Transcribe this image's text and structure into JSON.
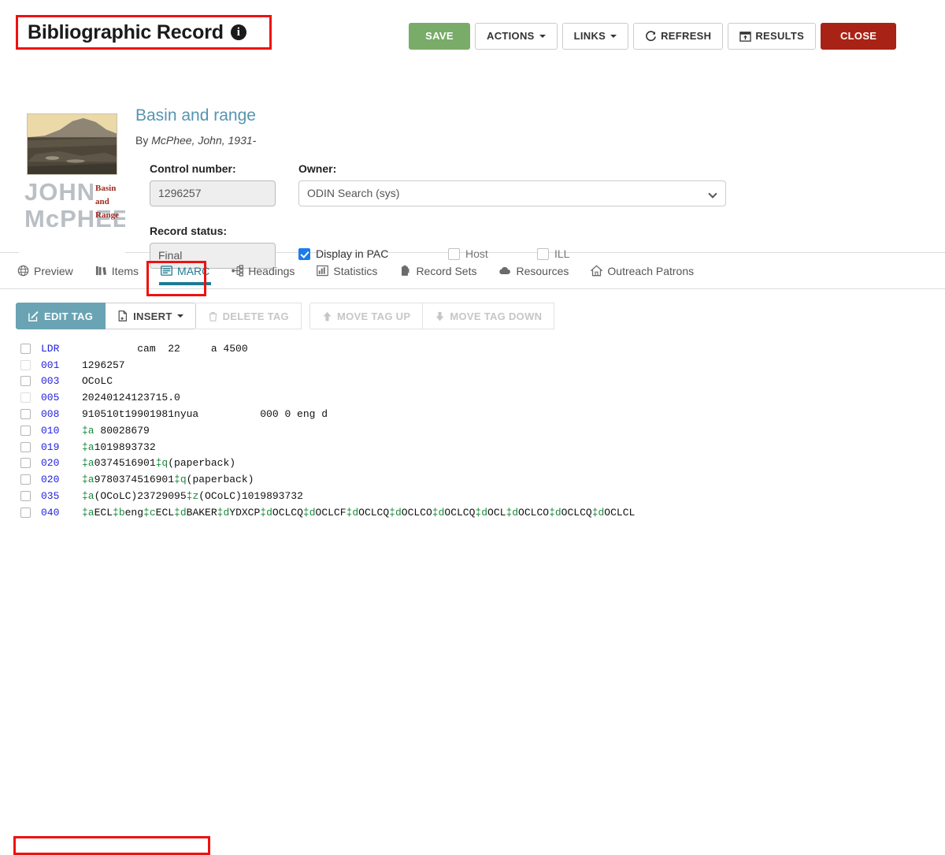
{
  "header": {
    "title": "Bibliographic Record",
    "info_icon": "info-circle-icon"
  },
  "toolbar": {
    "save": "SAVE",
    "actions": "ACTIONS",
    "links": "LINKS",
    "refresh": "REFRESH",
    "results": "RESULTS",
    "close": "CLOSE",
    "save_color": "#79ab69",
    "close_color": "#a82315"
  },
  "record": {
    "title": "Basin and range",
    "by_prefix": "By ",
    "author": "McPhee, John, 1931-",
    "cover": {
      "author_line1": "JOHN",
      "author_line2": "McPHEE",
      "title_line1": "Basin",
      "title_line2": "and",
      "title_line3": "Range"
    }
  },
  "form": {
    "control_number_label": "Control number:",
    "control_number_value": "1296257",
    "owner_label": "Owner:",
    "owner_value": "ODIN Search (sys)",
    "record_status_label": "Record status:",
    "record_status_value": "Final",
    "display_in_pac": "Display in PAC",
    "host": "Host",
    "ill": "ILL"
  },
  "tabs": [
    {
      "label": "Preview",
      "icon": "globe-icon",
      "active": false
    },
    {
      "label": "Items",
      "icon": "books-icon",
      "active": false
    },
    {
      "label": "MARC",
      "icon": "list-panel-icon",
      "active": true
    },
    {
      "label": "Headings",
      "icon": "sitemap-icon",
      "active": false
    },
    {
      "label": "Statistics",
      "icon": "bar-chart-icon",
      "active": false
    },
    {
      "label": "Record Sets",
      "icon": "clipboard-icon",
      "active": false
    },
    {
      "label": "Resources",
      "icon": "cloud-icon",
      "active": false
    },
    {
      "label": "Outreach Patrons",
      "icon": "home-icon",
      "active": false
    }
  ],
  "marc_toolbar": {
    "edit_tag": "EDIT TAG",
    "insert": "INSERT",
    "delete_tag": "DELETE TAG",
    "move_tag_up": "MOVE TAG UP",
    "move_tag_down": "MOVE TAG DOWN",
    "edit_tag_color": "#6aa3b3"
  },
  "marc_rows": [
    {
      "tag": "LDR",
      "checkbox_faint": false,
      "parts": [
        {
          "t": "         cam  22     a 4500",
          "sf": false
        }
      ]
    },
    {
      "tag": "001",
      "checkbox_faint": true,
      "parts": [
        {
          "t": "1296257",
          "sf": false
        }
      ]
    },
    {
      "tag": "003",
      "checkbox_faint": false,
      "parts": [
        {
          "t": "OCoLC",
          "sf": false
        }
      ]
    },
    {
      "tag": "005",
      "checkbox_faint": true,
      "parts": [
        {
          "t": "20240124123715.0",
          "sf": false
        }
      ]
    },
    {
      "tag": "008",
      "checkbox_faint": false,
      "parts": [
        {
          "t": "910510t19901981nyua          000 0 eng d",
          "sf": false
        }
      ]
    },
    {
      "tag": "010",
      "checkbox_faint": false,
      "parts": [
        {
          "t": "‡a",
          "sf": true
        },
        {
          "t": " 80028679",
          "sf": false
        }
      ]
    },
    {
      "tag": "019",
      "checkbox_faint": false,
      "parts": [
        {
          "t": "‡a",
          "sf": true
        },
        {
          "t": "1019893732",
          "sf": false
        }
      ]
    },
    {
      "tag": "020",
      "checkbox_faint": false,
      "parts": [
        {
          "t": "‡a",
          "sf": true
        },
        {
          "t": "0374516901",
          "sf": false
        },
        {
          "t": "‡q",
          "sf": true
        },
        {
          "t": "(paperback)",
          "sf": false
        }
      ]
    },
    {
      "tag": "020",
      "checkbox_faint": false,
      "parts": [
        {
          "t": "‡a",
          "sf": true
        },
        {
          "t": "9780374516901",
          "sf": false
        },
        {
          "t": "‡q",
          "sf": true
        },
        {
          "t": "(paperback)",
          "sf": false
        }
      ]
    },
    {
      "tag": "035",
      "checkbox_faint": false,
      "parts": [
        {
          "t": "‡a",
          "sf": true
        },
        {
          "t": "(OCoLC)23729095",
          "sf": false
        },
        {
          "t": "‡z",
          "sf": true
        },
        {
          "t": "(OCoLC)1019893732",
          "sf": false
        }
      ]
    },
    {
      "tag": "040",
      "checkbox_faint": false,
      "parts": [
        {
          "t": "‡a",
          "sf": true
        },
        {
          "t": "ECL",
          "sf": false
        },
        {
          "t": "‡b",
          "sf": true
        },
        {
          "t": "eng",
          "sf": false
        },
        {
          "t": "‡c",
          "sf": true
        },
        {
          "t": "ECL",
          "sf": false
        },
        {
          "t": "‡d",
          "sf": true
        },
        {
          "t": "BAKER",
          "sf": false
        },
        {
          "t": "‡d",
          "sf": true
        },
        {
          "t": "YDXCP",
          "sf": false
        },
        {
          "t": "‡d",
          "sf": true
        },
        {
          "t": "OCLCQ",
          "sf": false
        },
        {
          "t": "‡d",
          "sf": true
        },
        {
          "t": "OCLCF",
          "sf": false
        },
        {
          "t": "‡d",
          "sf": true
        },
        {
          "t": "OCLCQ",
          "sf": false
        },
        {
          "t": "‡d",
          "sf": true
        },
        {
          "t": "OCLCO",
          "sf": false
        },
        {
          "t": "‡d",
          "sf": true
        },
        {
          "t": "OCLCQ",
          "sf": false
        },
        {
          "t": "‡d",
          "sf": true
        },
        {
          "t": "OCL",
          "sf": false
        },
        {
          "t": "‡d",
          "sf": true
        },
        {
          "t": "OCLCO",
          "sf": false
        },
        {
          "t": "‡d",
          "sf": true
        },
        {
          "t": "OCLCQ",
          "sf": false
        },
        {
          "t": "‡d",
          "sf": true
        },
        {
          "t": "OCLCL",
          "sf": false
        }
      ]
    }
  ],
  "highlights": {
    "color": "#ee1111",
    "targets": [
      "page-title",
      "marc-tab",
      "marc-row-035"
    ]
  }
}
